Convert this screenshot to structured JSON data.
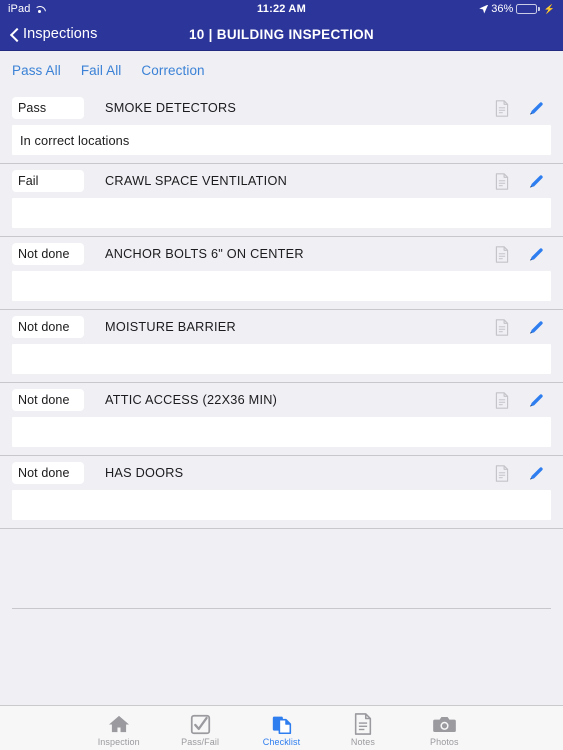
{
  "status_bar": {
    "device": "iPad",
    "wifi_icon": "wifi-icon",
    "time": "11:22 AM",
    "location_icon": "location-arrow-icon",
    "battery_percent": "36%",
    "battery_level": 36,
    "battery_charging": true,
    "battery_color": "#4cd964"
  },
  "nav": {
    "back_icon": "chevron-left-icon",
    "back_label": "Inspections",
    "title": "10 | BUILDING INSPECTION",
    "background_color": "#2c359a"
  },
  "actions": {
    "accent_color": "#3b82d6",
    "items": [
      {
        "label": "Pass All",
        "name": "pass-all-button"
      },
      {
        "label": "Fail All",
        "name": "fail-all-button"
      },
      {
        "label": "Correction",
        "name": "correction-button"
      }
    ]
  },
  "checklist": {
    "note_placeholder": "",
    "rows": [
      {
        "status": "Pass",
        "label": "SMOKE DETECTORS",
        "note": "In correct locations",
        "document_icon": "document-icon",
        "edit_icon": "pencil-icon"
      },
      {
        "status": "Fail",
        "label": "CRAWL SPACE VENTILATION",
        "note": "",
        "document_icon": "document-icon",
        "edit_icon": "pencil-icon"
      },
      {
        "status": "Not done",
        "label": "ANCHOR BOLTS 6\" ON CENTER",
        "note": "",
        "document_icon": "document-icon",
        "edit_icon": "pencil-icon"
      },
      {
        "status": "Not done",
        "label": "MOISTURE BARRIER",
        "note": "",
        "document_icon": "document-icon",
        "edit_icon": "pencil-icon"
      },
      {
        "status": "Not done",
        "label": "ATTIC ACCESS (22X36 MIN)",
        "note": "",
        "document_icon": "document-icon",
        "edit_icon": "pencil-icon"
      },
      {
        "status": "Not done",
        "label": "HAS DOORS",
        "note": "",
        "document_icon": "document-icon",
        "edit_icon": "pencil-icon"
      }
    ]
  },
  "tab_bar": {
    "active_color": "#2f7ef0",
    "inactive_color": "#9a9a9f",
    "tabs": [
      {
        "label": "Inspection",
        "icon": "home-icon",
        "active": false
      },
      {
        "label": "Pass/Fail",
        "icon": "check-square-icon",
        "active": false
      },
      {
        "label": "Checklist",
        "icon": "documents-stack-icon",
        "active": true
      },
      {
        "label": "Notes",
        "icon": "notes-page-icon",
        "active": false
      },
      {
        "label": "Photos",
        "icon": "camera-icon",
        "active": false
      }
    ]
  }
}
